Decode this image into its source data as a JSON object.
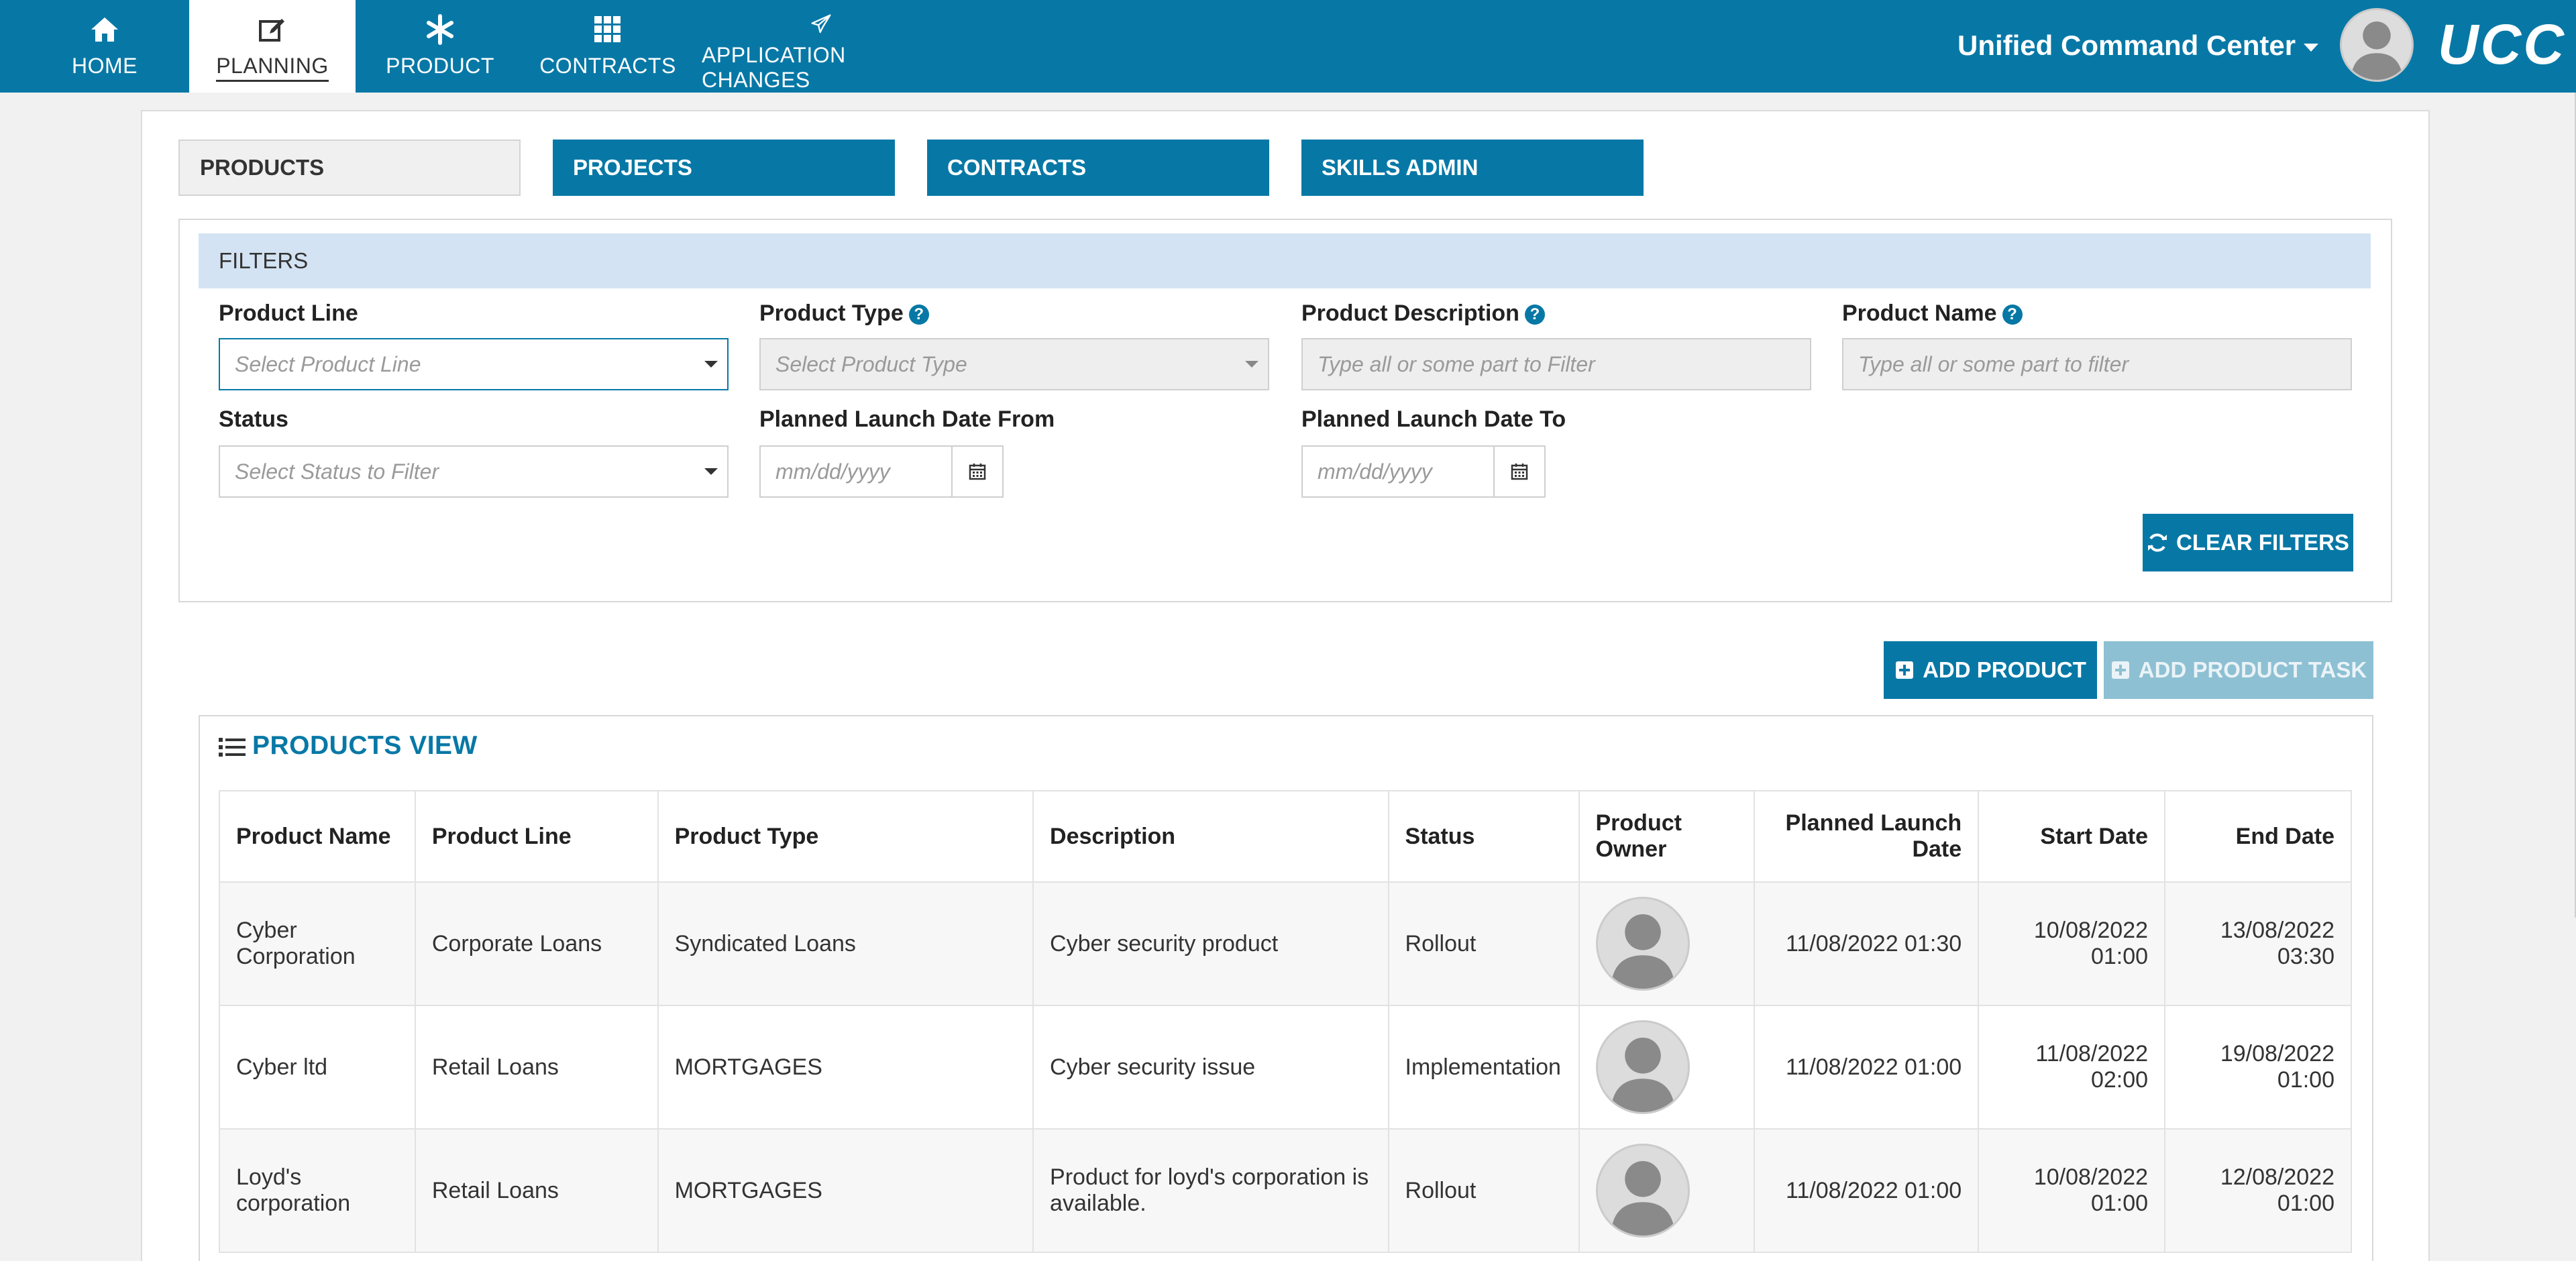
{
  "nav": {
    "tabs": [
      {
        "label": "HOME",
        "icon": "home-icon"
      },
      {
        "label": "PLANNING",
        "icon": "edit-icon",
        "active": true
      },
      {
        "label": "PRODUCT",
        "icon": "asterisk-icon"
      },
      {
        "label": "CONTRACTS",
        "icon": "grid-icon"
      },
      {
        "label": "APPLICATION CHANGES",
        "icon": "paper-plane-icon"
      }
    ],
    "app_menu": "Unified Command Center",
    "brand": "UCC"
  },
  "subtabs": [
    {
      "label": "PRODUCTS",
      "active": true
    },
    {
      "label": "PROJECTS"
    },
    {
      "label": "CONTRACTS"
    },
    {
      "label": "SKILLS ADMIN"
    }
  ],
  "filters": {
    "header": "FILTERS",
    "product_line": {
      "label": "Product Line",
      "placeholder": "Select Product Line"
    },
    "product_type": {
      "label": "Product Type",
      "placeholder": "Select Product Type"
    },
    "product_description": {
      "label": "Product Description",
      "placeholder": "Type all or some part to Filter"
    },
    "product_name": {
      "label": "Product Name",
      "placeholder": "Type all or some part to filter"
    },
    "status": {
      "label": "Status",
      "placeholder": "Select Status to Filter"
    },
    "launch_from": {
      "label": "Planned Launch Date From",
      "placeholder": "mm/dd/yyyy"
    },
    "launch_to": {
      "label": "Planned Launch Date To",
      "placeholder": "mm/dd/yyyy"
    },
    "clear_label": "CLEAR FILTERS"
  },
  "actions": {
    "add_product": "ADD PRODUCT",
    "add_product_task": "ADD PRODUCT TASK"
  },
  "products_view": {
    "title": "PRODUCTS VIEW",
    "columns": {
      "product_name": "Product Name",
      "product_line": "Product Line",
      "product_type": "Product Type",
      "description": "Description",
      "status": "Status",
      "owner_1": "Product",
      "owner_2": "Owner",
      "launch_1": "Planned Launch",
      "launch_2": "Date",
      "start": "Start Date",
      "end": "End Date"
    },
    "rows": [
      {
        "name_1": "Cyber",
        "name_2": "Corporation",
        "line": "Corporate Loans",
        "type": "Syndicated Loans",
        "desc_1": "Cyber security product",
        "desc_2": "",
        "status": "Rollout",
        "launch": "11/08/2022 01:30",
        "start_1": "10/08/2022",
        "start_2": "01:00",
        "end_1": "13/08/2022",
        "end_2": "03:30"
      },
      {
        "name_1": "Cyber ltd",
        "name_2": "",
        "line": "Retail Loans",
        "type": "MORTGAGES",
        "desc_1": "Cyber security issue",
        "desc_2": "",
        "status": "Implementation",
        "launch": "11/08/2022 01:00",
        "start_1": "11/08/2022",
        "start_2": "02:00",
        "end_1": "19/08/2022",
        "end_2": "01:00"
      },
      {
        "name_1": "Loyd's",
        "name_2": "corporation",
        "line": "Retail Loans",
        "type": "MORTGAGES",
        "desc_1": "Product for loyd's corporation is",
        "desc_2": "available.",
        "status": "Rollout",
        "launch": "11/08/2022 01:00",
        "start_1": "10/08/2022",
        "start_2": "01:00",
        "end_1": "12/08/2022",
        "end_2": "01:00"
      }
    ]
  },
  "colors": {
    "primary": "#0778a6",
    "filters_header_bg": "#d3e3f3",
    "disabled_button": "#8dc0d3"
  }
}
